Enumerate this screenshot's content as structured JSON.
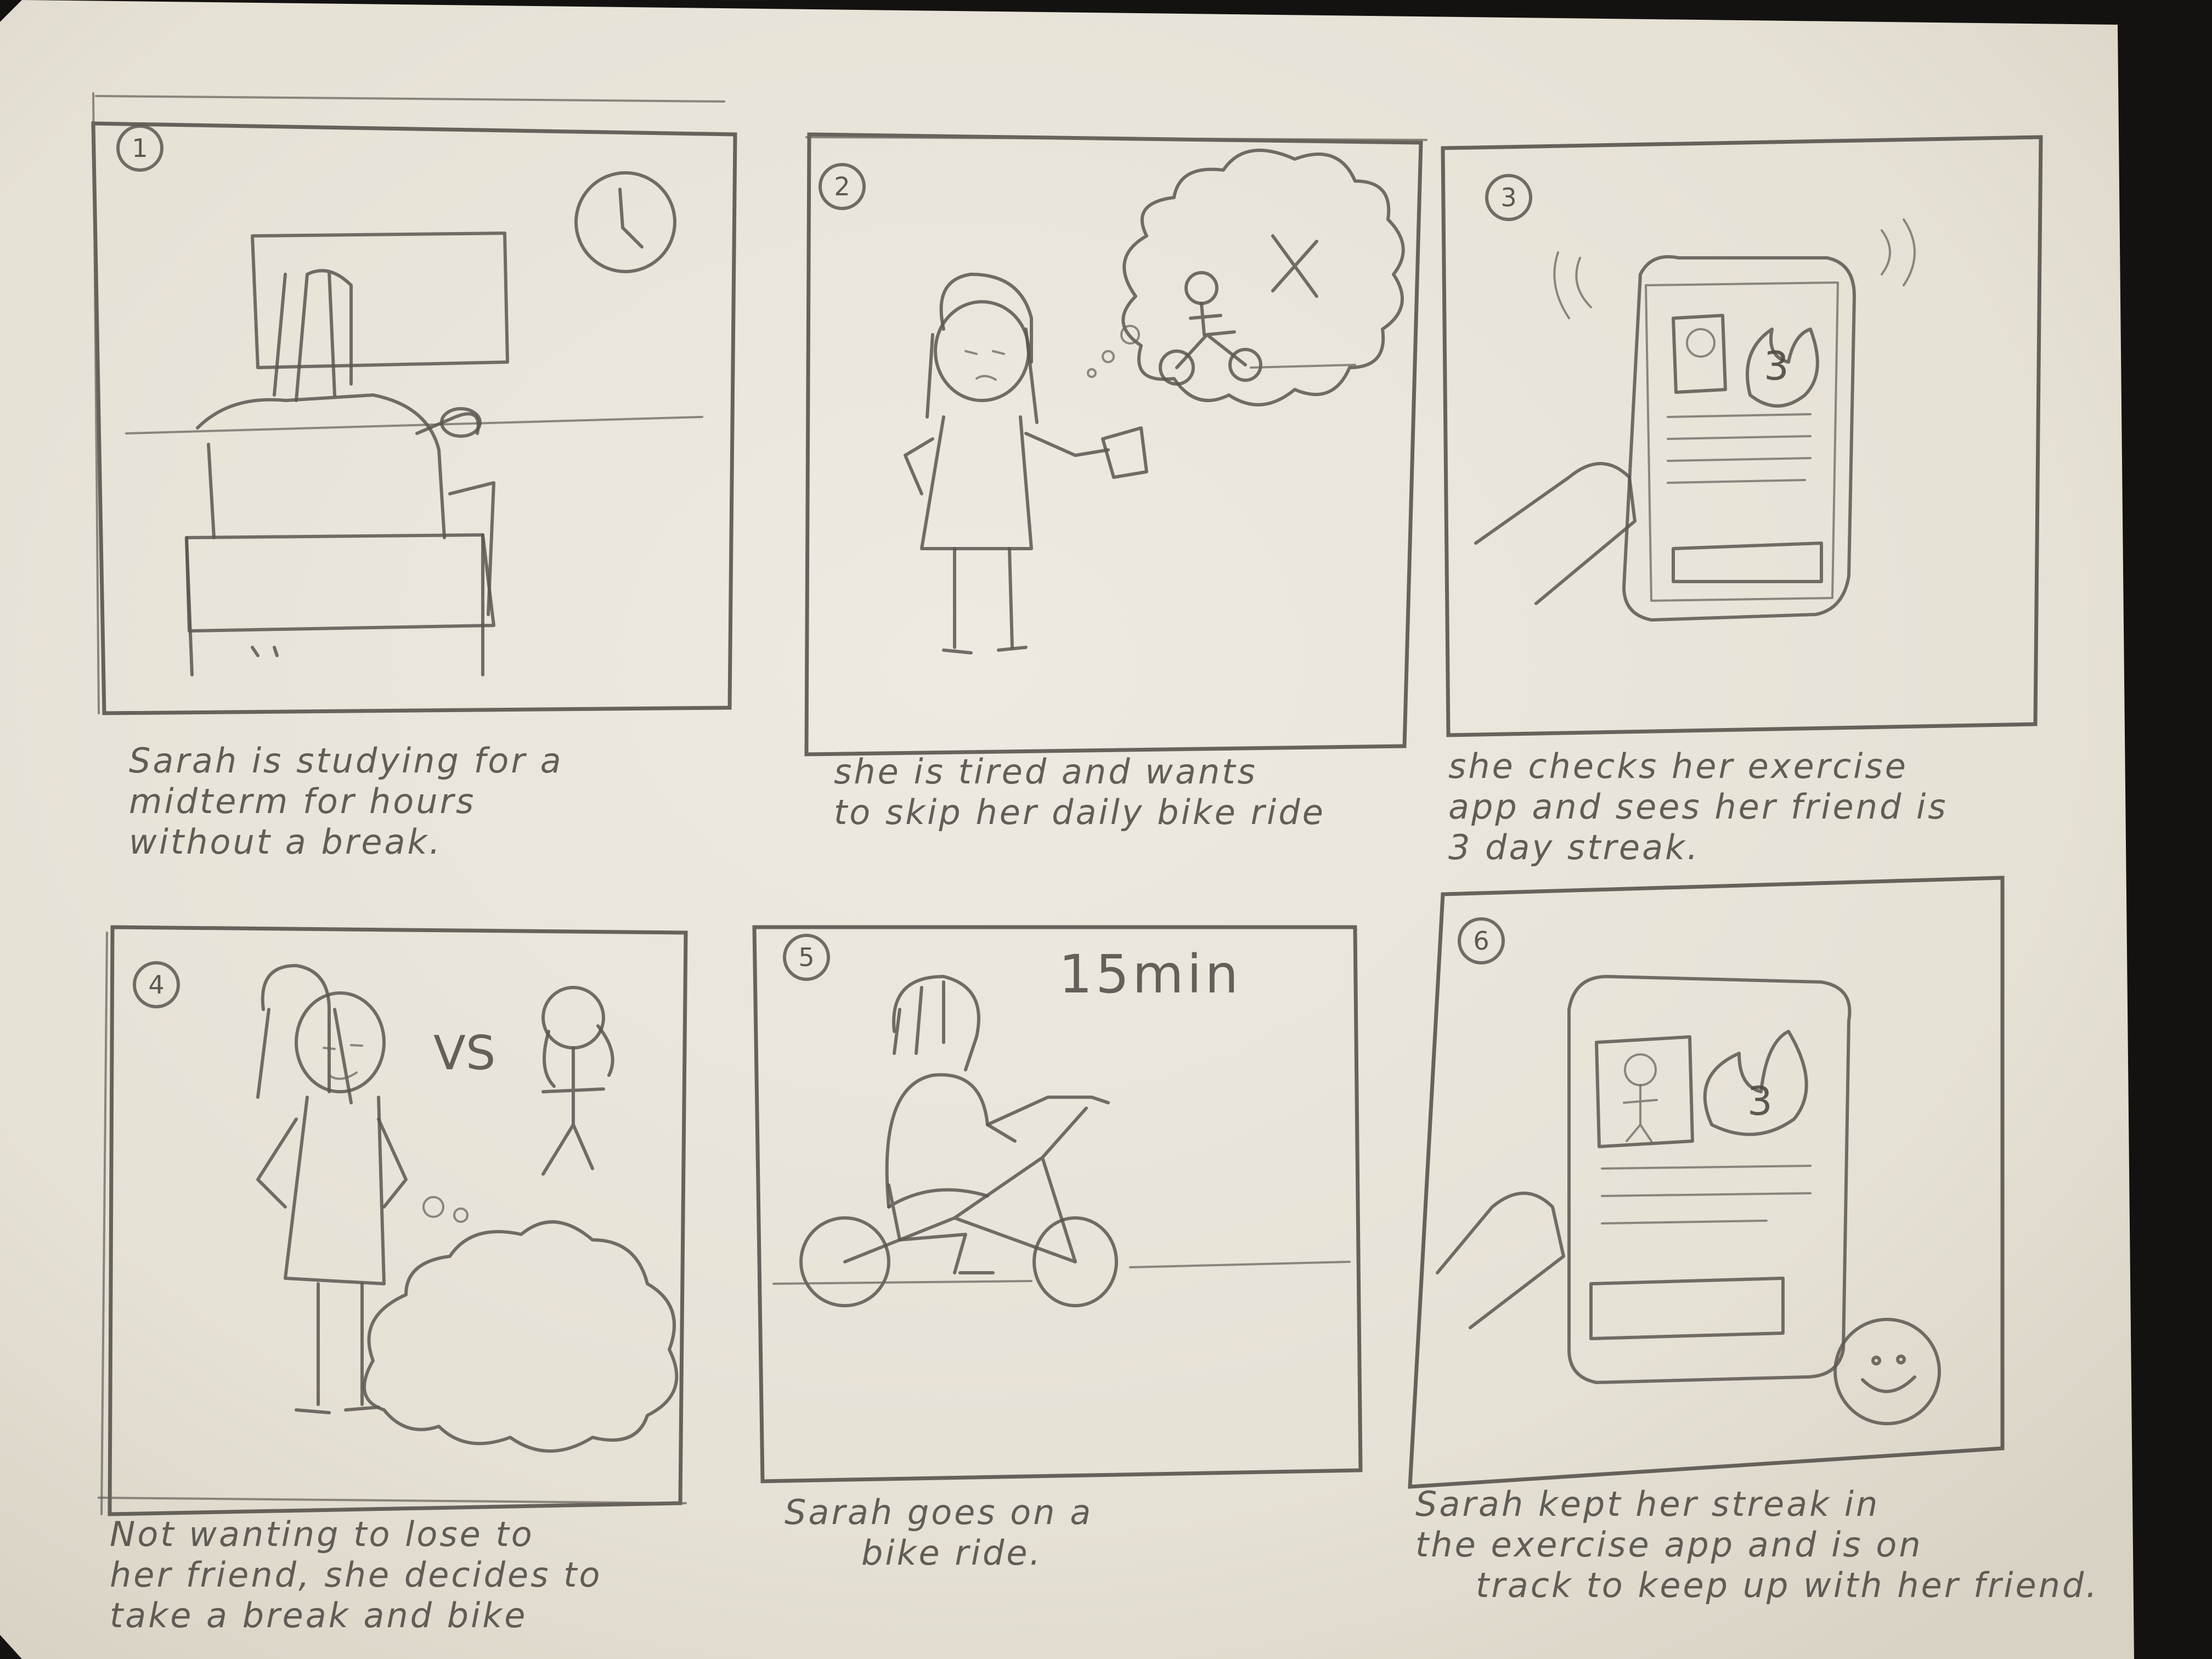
{
  "storyboard": {
    "panels": [
      {
        "number": "1",
        "caption": [
          "Sarah is studying for a",
          "midterm for hours",
          "without a break."
        ]
      },
      {
        "number": "2",
        "caption": [
          "she is tired and wants",
          "to skip her daily bike ride"
        ]
      },
      {
        "number": "3",
        "caption": [
          "she checks her exercise",
          "app and sees her friend is",
          "3 day streak."
        ]
      },
      {
        "number": "4",
        "caption": [
          "Not wanting to lose to",
          "her friend, she decides to",
          "take a break and bike"
        ],
        "vs_label": "VS"
      },
      {
        "number": "5",
        "caption": [
          "Sarah goes on a",
          "bike ride."
        ],
        "timer_label": "15min"
      },
      {
        "number": "6",
        "caption": [
          "Sarah kept her streak in",
          "the exercise app and is on",
          "track to keep up with her friend."
        ]
      }
    ],
    "streak_count": "3"
  },
  "colors": {
    "paper": "#e9e4d9",
    "pencil": "#5a5650",
    "background": "#141210"
  }
}
